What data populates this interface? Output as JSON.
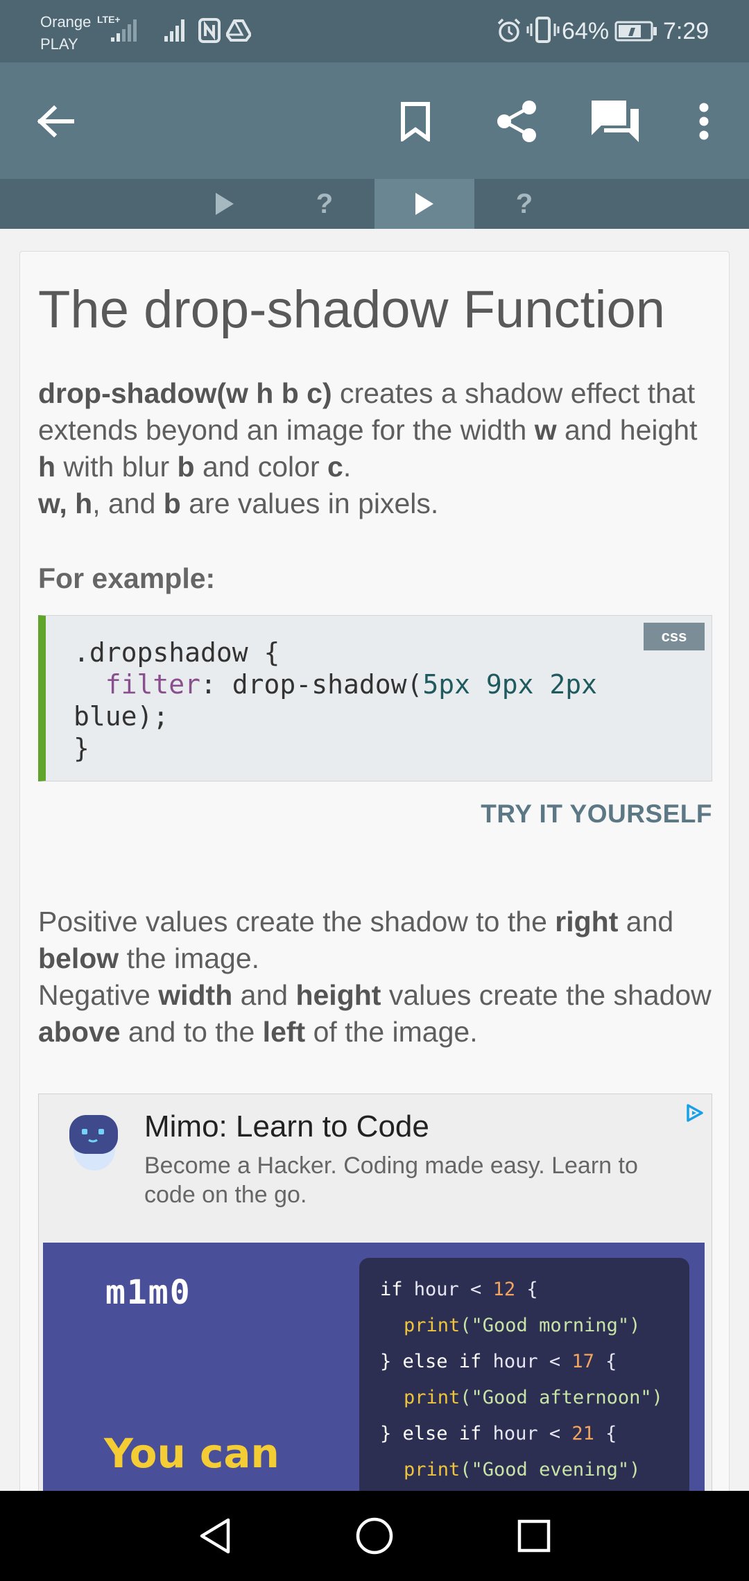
{
  "status_bar": {
    "carrier_line1": "Orange",
    "carrier_line2": "PLAY",
    "network_type": "LTE+",
    "battery_percent": "64%",
    "time": "7:29"
  },
  "app_bar": {
    "icons": [
      "back-arrow-icon",
      "bookmark-icon",
      "share-icon",
      "comments-icon",
      "more-vert-icon"
    ]
  },
  "lesson_tabs": [
    {
      "type": "play",
      "active": false
    },
    {
      "type": "quiz",
      "label": "?",
      "active": false
    },
    {
      "type": "play",
      "active": true
    },
    {
      "type": "quiz",
      "label": "?",
      "active": false
    }
  ],
  "lesson": {
    "title": "The drop-shadow Function",
    "intro": {
      "fn_signature": "drop-shadow(w h b c)",
      "t1": " creates a shadow effect that extends beyond an image for the width ",
      "w": "w",
      "t2": " and height ",
      "h": "h",
      "t3": " with blur ",
      "b": "b",
      "t4": " and color ",
      "c": "c",
      "t5": ".",
      "vars": "w, h",
      "t6": ", and ",
      "b2": "b",
      "t7": " are values in pixels."
    },
    "for_example": "For example:",
    "code": {
      "lang": "css",
      "line1": ".dropshadow {",
      "prop": "filter",
      "colon": ": drop-shadow(",
      "nums": "5px 9px 2px",
      "line3": "blue);",
      "line4": "}"
    },
    "try_it": "TRY IT YOURSELF",
    "explanation": {
      "t1": "Positive values create the shadow to the ",
      "right": "right",
      "t2": " and ",
      "below": "below",
      "t3": " the image.",
      "t4": "Negative ",
      "width": "width",
      "t5": " and ",
      "height": "height",
      "t6": " values create the shadow ",
      "above": "above",
      "t7": " and to the ",
      "left": "left",
      "t8": " of the image."
    }
  },
  "ad": {
    "title": "Mimo: Learn to Code",
    "description": "Become a Hacker. Coding made easy. Learn to code on the go.",
    "brand": "m1m0",
    "tagline": "You can",
    "code_lines": [
      {
        "kw1": "if",
        "var": " hour < ",
        "num": "12",
        "end": " {"
      },
      {
        "fn": "print",
        "str": "(\"Good morning\")"
      },
      {
        "kw1": "} else if",
        "var": " hour < ",
        "num": "17",
        "end": " {"
      },
      {
        "fn": "print",
        "str": "(\"Good afternoon\")"
      },
      {
        "kw1": "} else if",
        "var": " hour < ",
        "num": "21",
        "end": " {"
      },
      {
        "fn": "print",
        "str": "(\"Good evening\")"
      }
    ]
  },
  "nav_bar": {
    "icons": [
      "nav-back-icon",
      "nav-home-icon",
      "nav-recents-icon"
    ]
  },
  "colors": {
    "toolbar": "#5c7885",
    "status_bar": "#4e6671",
    "code_accent": "#5fa52c",
    "link": "#5c7885"
  }
}
